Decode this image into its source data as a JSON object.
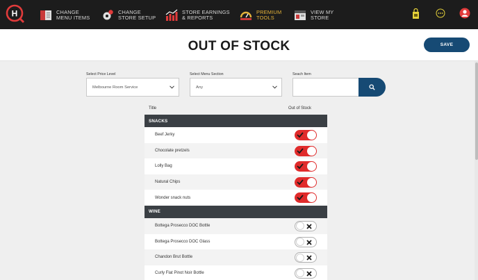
{
  "nav": {
    "items": [
      {
        "label": "CHANGE\nMENU ITEMS",
        "icon": "menu-items-icon"
      },
      {
        "label": "CHANGE\nSTORE SETUP",
        "icon": "store-setup-gear-icon"
      },
      {
        "label": "STORE EARNINGS\n& REPORTS",
        "icon": "bar-chart-icon"
      },
      {
        "label": "PREMIUM\nTOOLS",
        "icon": "premium-gauge-icon"
      },
      {
        "label": "VIEW MY\nSTORE",
        "icon": "storefront-icon"
      }
    ],
    "right_icons": [
      "store-bag-icon",
      "more-options-icon",
      "user-profile-icon"
    ]
  },
  "header": {
    "title": "OUT OF STOCK",
    "save_label": "SAVE"
  },
  "filters": {
    "price_level_label": "Select Price Level",
    "price_level_value": "Melbourne Room Service",
    "menu_section_label": "Select Menu Section",
    "menu_section_value": "Any",
    "search_label": "Seach Item",
    "search_value": ""
  },
  "table": {
    "col_title": "Title",
    "col_out_of_stock": "Out of Stock",
    "sections": [
      {
        "name": "SNACKS",
        "items": [
          {
            "title": "Beef Jerky",
            "out_of_stock": true
          },
          {
            "title": "Chocolate pretzels",
            "out_of_stock": true
          },
          {
            "title": "Lolly Bag",
            "out_of_stock": true
          },
          {
            "title": "Natural Chips",
            "out_of_stock": true
          },
          {
            "title": "Wonder snack nuts",
            "out_of_stock": true
          }
        ]
      },
      {
        "name": "WINE",
        "items": [
          {
            "title": "Bottega Prosecco DOC Bottle",
            "out_of_stock": false
          },
          {
            "title": "Bottega Prosecco DOC Glass",
            "out_of_stock": false
          },
          {
            "title": "Chandon Brut Bottle",
            "out_of_stock": false
          },
          {
            "title": "Curly Flat Pinot Noir Bottle",
            "out_of_stock": false
          }
        ]
      }
    ]
  },
  "colors": {
    "nav_bg": "#1c1c1c",
    "accent_blue": "#164a74",
    "toggle_on": "#e02b2b",
    "section_bg": "#3a3f44",
    "premium": "#e6b33a"
  }
}
